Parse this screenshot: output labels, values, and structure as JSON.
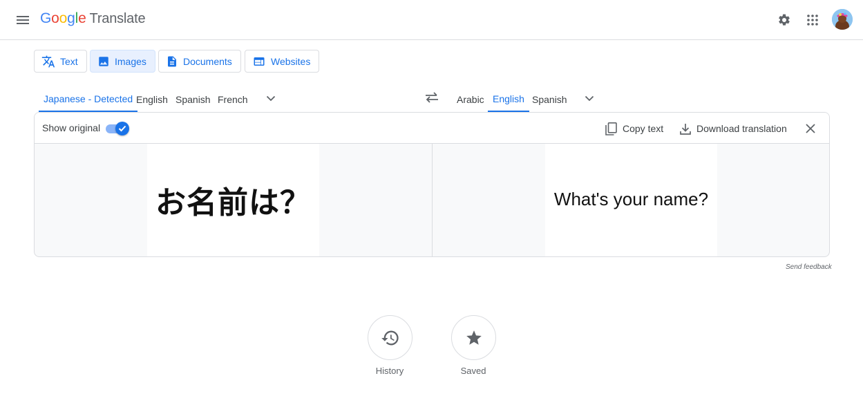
{
  "header": {
    "logo_letters": [
      "G",
      "o",
      "o",
      "g",
      "l",
      "e"
    ],
    "logo_colors": [
      "#4285f4",
      "#ea4335",
      "#fbbc05",
      "#4285f4",
      "#34a853",
      "#ea4335"
    ],
    "product_name": "Translate"
  },
  "modes": [
    {
      "label": "Text",
      "icon": "translate-icon",
      "active": false
    },
    {
      "label": "Images",
      "icon": "image-icon",
      "active": true
    },
    {
      "label": "Documents",
      "icon": "document-icon",
      "active": false
    },
    {
      "label": "Websites",
      "icon": "website-icon",
      "active": false
    }
  ],
  "source_languages": [
    "Japanese - Detected",
    "English",
    "Spanish",
    "French"
  ],
  "source_active": "Japanese - Detected",
  "target_languages": [
    "Arabic",
    "English",
    "Spanish"
  ],
  "target_active": "English",
  "toolbar": {
    "show_original_label": "Show original",
    "show_original_on": true,
    "copy_label": "Copy text",
    "download_label": "Download translation"
  },
  "source_text": "お名前は？",
  "translated_text": "What's your name?",
  "send_feedback": "Send feedback",
  "bottom_actions": {
    "history_label": "History",
    "saved_label": "Saved"
  },
  "colors": {
    "accent": "#1a73e8",
    "active_tab_bg": "#e8f0fe",
    "border": "#dadce0",
    "image_bg": "#f8f9fa"
  }
}
